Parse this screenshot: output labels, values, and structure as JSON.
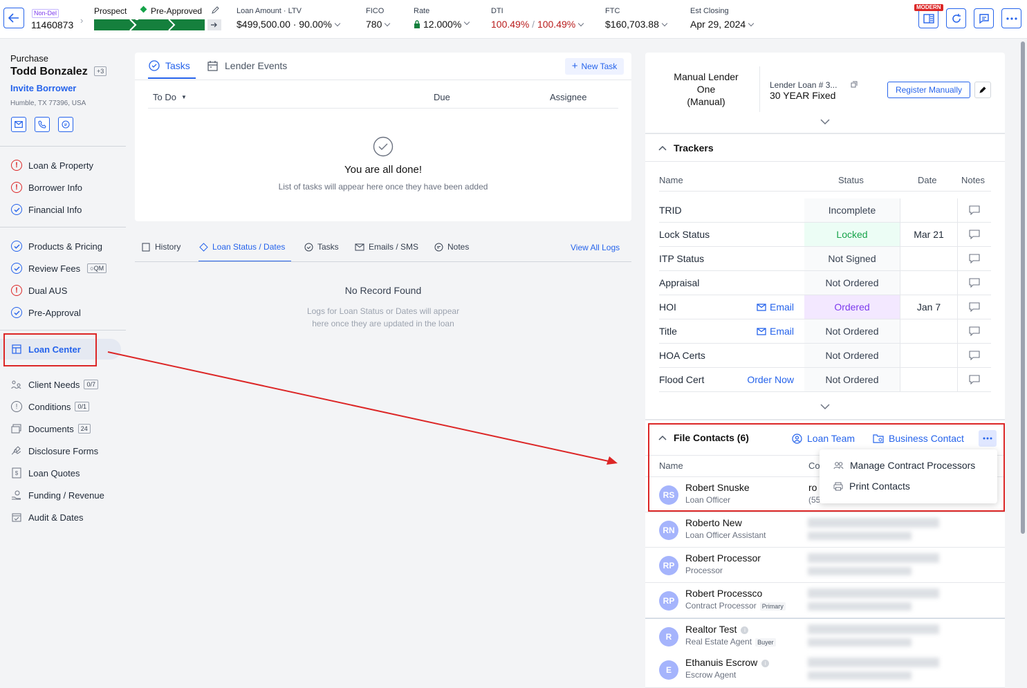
{
  "header": {
    "loan_tag": "Non-Del",
    "loan_number": "11460873",
    "stage_from": "Prospect",
    "stage_to": "Pre-Approved",
    "loan_amount_label": "Loan Amount · LTV",
    "loan_amount_value": "$499,500.00 · 90.00%",
    "fico_label": "FICO",
    "fico_value": "780",
    "rate_label": "Rate",
    "rate_value": "12.000%",
    "dti_label": "DTI",
    "dti_value_a": "100.49%",
    "dti_sep": "/",
    "dti_value_b": "100.49%",
    "ftc_label": "FTC",
    "ftc_value": "$160,703.88",
    "closing_label": "Est Closing",
    "closing_value": "Apr 29, 2024",
    "modern_badge": "MODERN"
  },
  "sidebar": {
    "purpose": "Purchase",
    "borrower_name": "Todd Bonzalez",
    "borrower_extra": "+3",
    "invite_label": "Invite Borrower",
    "address": "Humble, TX 77396, USA",
    "items": [
      {
        "label": "Loan & Property",
        "status": "warn"
      },
      {
        "label": "Borrower Info",
        "status": "warn"
      },
      {
        "label": "Financial Info",
        "status": "ok"
      },
      {
        "label": "Products & Pricing",
        "status": "ok"
      },
      {
        "label": "Review Fees",
        "status": "ok",
        "badge": "QM"
      },
      {
        "label": "Dual AUS",
        "status": "warn"
      },
      {
        "label": "Pre-Approval",
        "status": "ok"
      },
      {
        "label": "Loan Center"
      },
      {
        "label": "Client Needs",
        "count": "0/7"
      },
      {
        "label": "Conditions",
        "count": "0/1"
      },
      {
        "label": "Documents",
        "count": "24"
      },
      {
        "label": "Disclosure Forms"
      },
      {
        "label": "Loan Quotes"
      },
      {
        "label": "Funding / Revenue"
      },
      {
        "label": "Audit & Dates"
      }
    ]
  },
  "tasks": {
    "tab_tasks": "Tasks",
    "tab_lender_events": "Lender Events",
    "new_task": "New Task",
    "col_todo": "To Do",
    "col_due": "Due",
    "col_assignee": "Assignee",
    "empty_title": "You are all done!",
    "empty_sub": "List of tasks will appear here once they have been added"
  },
  "logs": {
    "tabs": [
      "History",
      "Loan Status / Dates",
      "Tasks",
      "Emails / SMS",
      "Notes"
    ],
    "view_all": "View All Logs",
    "empty_title": "No Record Found",
    "empty_sub_1": "Logs for Loan Status or Dates will appear",
    "empty_sub_2": "here once they are updated in the loan"
  },
  "lender": {
    "name_1": "Manual Lender",
    "name_2": "One",
    "name_3": "(Manual)",
    "loan_no_label": "Lender Loan # 3...",
    "product": "30 YEAR Fixed",
    "register_btn": "Register Manually"
  },
  "trackers": {
    "title": "Trackers",
    "col_name": "Name",
    "col_status": "Status",
    "col_date": "Date",
    "col_notes": "Notes",
    "rows": [
      {
        "name": "TRID",
        "action": "",
        "status": "Incomplete",
        "date": ""
      },
      {
        "name": "Lock Status",
        "action": "",
        "status": "Locked",
        "date": "Mar 21"
      },
      {
        "name": "ITP Status",
        "action": "",
        "status": "Not Signed",
        "date": ""
      },
      {
        "name": "Appraisal",
        "action": "",
        "status": "Not Ordered",
        "date": ""
      },
      {
        "name": "HOI",
        "action": "Email",
        "status": "Ordered",
        "date": "Jan 7"
      },
      {
        "name": "Title",
        "action": "Email",
        "status": "Not Ordered",
        "date": ""
      },
      {
        "name": "HOA Certs",
        "action": "",
        "status": "Not Ordered",
        "date": ""
      },
      {
        "name": "Flood Cert",
        "action": "Order Now",
        "status": "Not Ordered",
        "date": ""
      }
    ],
    "status_colors": {
      "Locked": "#16a34a",
      "Ordered": "#7c3aed"
    }
  },
  "contacts": {
    "title": "File Contacts (6)",
    "loan_team": "Loan Team",
    "business_contact": "Business Contact",
    "col_name": "Name",
    "col_contact": "Co",
    "menu": [
      "Manage Contract Processors",
      "Print Contacts"
    ],
    "rows": [
      {
        "initials": "RS",
        "name": "Robert Snuske",
        "role": "Loan Officer",
        "badge": "",
        "peek_1": "ro",
        "peek_2": "(55"
      },
      {
        "initials": "RN",
        "name": "Roberto New",
        "role": "Loan Officer Assistant",
        "badge": ""
      },
      {
        "initials": "RP",
        "name": "Robert Processor",
        "role": "Processor",
        "badge": ""
      },
      {
        "initials": "RP",
        "name": "Robert Processco",
        "role": "Contract Processor",
        "badge": "Primary"
      },
      {
        "initials": "R",
        "name": "Realtor Test",
        "role": "Real Estate Agent",
        "badge": "Buyer"
      },
      {
        "initials": "E",
        "name": "Ethanuis Escrow",
        "role": "Escrow Agent",
        "badge": ""
      }
    ]
  }
}
